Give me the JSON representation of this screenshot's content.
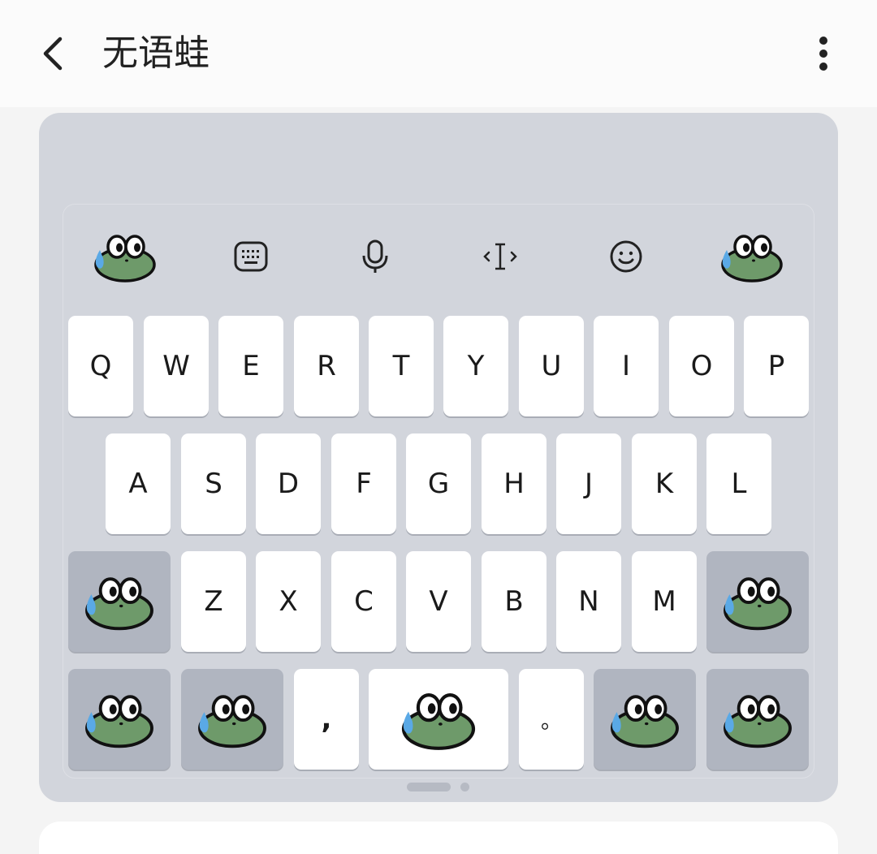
{
  "header": {
    "title": "无语蛙",
    "back_icon": "chevron-left-icon",
    "more_icon": "more-vert-icon"
  },
  "keyboard": {
    "toolbar": [
      {
        "name": "frog-sticker-icon"
      },
      {
        "name": "keyboard-icon"
      },
      {
        "name": "mic-icon"
      },
      {
        "name": "text-cursor-icon"
      },
      {
        "name": "emoji-icon"
      },
      {
        "name": "frog-sticker-icon"
      }
    ],
    "row1": [
      "Q",
      "W",
      "E",
      "R",
      "T",
      "Y",
      "U",
      "I",
      "O",
      "P"
    ],
    "row2": [
      "A",
      "S",
      "D",
      "F",
      "G",
      "H",
      "J",
      "K",
      "L"
    ],
    "row3": [
      "Z",
      "X",
      "C",
      "V",
      "B",
      "N",
      "M"
    ],
    "row4": {
      "comma": ",",
      "period": "。"
    }
  },
  "colors": {
    "card_bg": "#d2d5dc",
    "key_bg": "#ffffff",
    "function_key_bg": "#b0b5c0",
    "frog_green": "#6e9a6a",
    "tear_blue": "#5aa9e6"
  }
}
